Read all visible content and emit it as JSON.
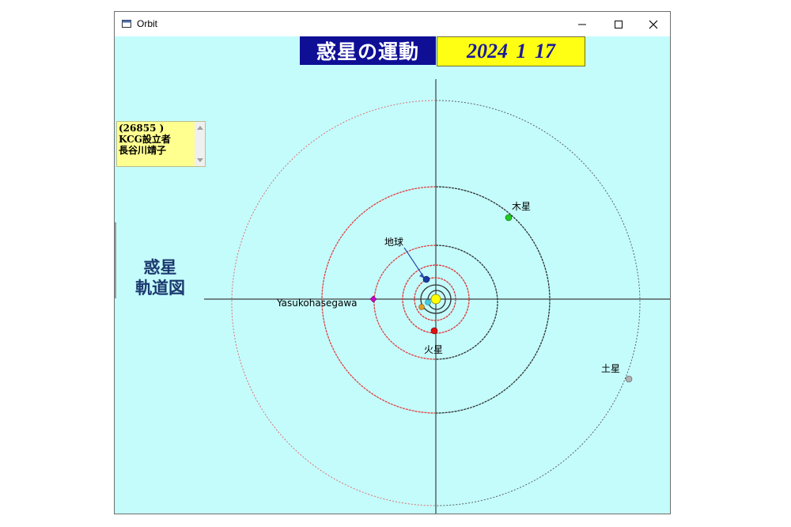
{
  "window": {
    "title": "Orbit"
  },
  "banner": {
    "title": "惑星の運動",
    "date": "2024 1 17"
  },
  "info_box": {
    "lines": [
      "(26855 )",
      "KCG設立者",
      "長谷川靖子"
    ]
  },
  "side_heading": {
    "line1": "惑星",
    "line2": "軌道図"
  },
  "labels": {
    "earth": "地球",
    "mars": "火星",
    "jupiter": "木星",
    "saturn": "土星",
    "asteroid": "Yasukohasegawa"
  },
  "colors": {
    "window_bg": "#c4fcfc",
    "title_bg": "#0f0f96",
    "date_bg": "#ffff14",
    "info_bg": "#ffff90",
    "orbit_red": "#e04040",
    "orbit_dark": "#303030",
    "sun": "#ffff00",
    "earth": "#1a3aa0",
    "mars": "#e01010",
    "jupiter": "#22cc22",
    "saturn": "#b0b0b0",
    "asteroid": "#cc00cc",
    "mercury": "#40d0e0",
    "venus": "#e0a020"
  },
  "icons": {
    "app": "orbit-app-icon",
    "minimize": "minimize-icon",
    "maximize": "maximize-icon",
    "close": "close-icon"
  }
}
